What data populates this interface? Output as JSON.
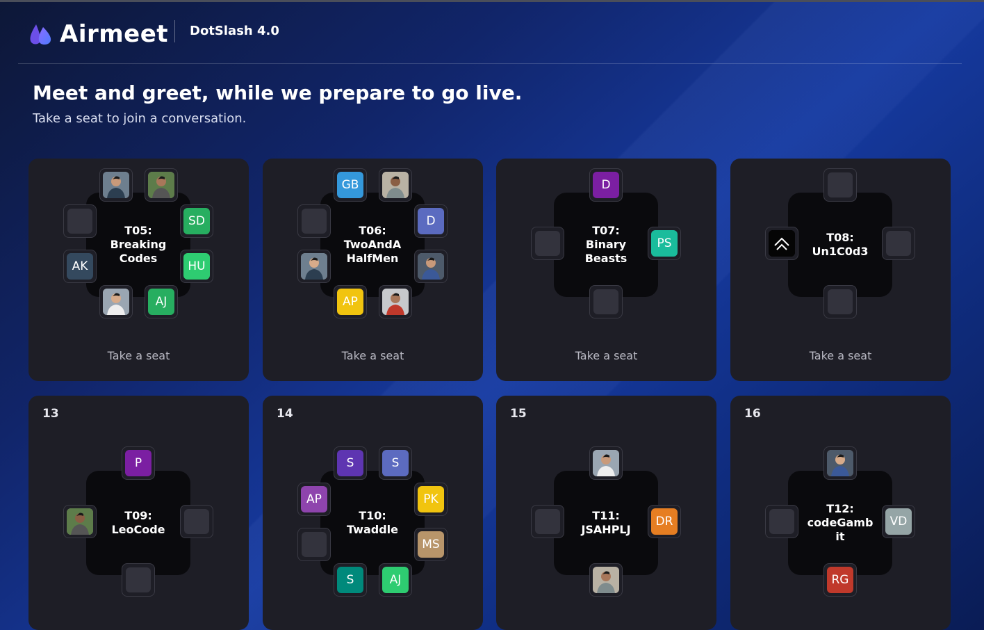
{
  "brand": {
    "name": "Airmeet"
  },
  "event": {
    "name": "DotSlash 4.0"
  },
  "lounge": {
    "heading": "Meet and greet, while we prepare to go live.",
    "subheading": "Take a seat to join a conversation.",
    "take_seat_label": "Take a seat"
  },
  "tables": [
    {
      "number": "",
      "name": "T05: Breaking Codes",
      "seats": [
        {
          "type": "photo"
        },
        {
          "type": "photo"
        },
        {
          "type": "initials",
          "text": "SD",
          "color": "#27ae60"
        },
        {
          "type": "initials",
          "text": "HU",
          "color": "#2ecc71"
        },
        {
          "type": "initials",
          "text": "AJ",
          "color": "#27ae60"
        },
        {
          "type": "photo"
        },
        {
          "type": "initials",
          "text": "AK",
          "color": "#34495e"
        },
        {
          "type": "empty"
        }
      ]
    },
    {
      "number": "",
      "name": "T06: TwoAndA HalfMen",
      "seats": [
        {
          "type": "initials",
          "text": "GB",
          "color": "#3498db"
        },
        {
          "type": "photo"
        },
        {
          "type": "initials",
          "text": "D",
          "color": "#5b6bc0"
        },
        {
          "type": "photo"
        },
        {
          "type": "photo"
        },
        {
          "type": "initials",
          "text": "AP",
          "color": "#f1c40f"
        },
        {
          "type": "photo"
        },
        {
          "type": "empty"
        }
      ]
    },
    {
      "number": "",
      "name": "T07: Binary Beasts",
      "seats": [
        {
          "type": "initials",
          "text": "D",
          "color": "#7b1fa2"
        },
        {
          "type": "initials",
          "text": "PS",
          "color": "#1abc9c"
        },
        {
          "type": "empty"
        },
        {
          "type": "empty"
        }
      ]
    },
    {
      "number": "",
      "name": "T08: Un1C0d3",
      "seats": [
        {
          "type": "empty"
        },
        {
          "type": "empty"
        },
        {
          "type": "empty"
        },
        {
          "type": "logo"
        }
      ]
    },
    {
      "number": "13",
      "name": "T09: LeoCode",
      "seats": [
        {
          "type": "initials",
          "text": "P",
          "color": "#7b1fa2"
        },
        {
          "type": "empty"
        },
        {
          "type": "empty"
        },
        {
          "type": "photo"
        }
      ]
    },
    {
      "number": "14",
      "name": "T10: Twaddle",
      "seats": [
        {
          "type": "initials",
          "text": "S",
          "color": "#5e35b1"
        },
        {
          "type": "initials",
          "text": "S",
          "color": "#5c6bc0"
        },
        {
          "type": "initials",
          "text": "PK",
          "color": "#f1c40f"
        },
        {
          "type": "initials",
          "text": "MS",
          "color": "#b8956a"
        },
        {
          "type": "initials",
          "text": "AJ",
          "color": "#2ecc71"
        },
        {
          "type": "initials",
          "text": "S",
          "color": "#00897b"
        },
        {
          "type": "empty"
        },
        {
          "type": "initials",
          "text": "AP",
          "color": "#8e44ad"
        }
      ]
    },
    {
      "number": "15",
      "name": "T11: JSAHPLJ",
      "seats": [
        {
          "type": "photo"
        },
        {
          "type": "initials",
          "text": "DR",
          "color": "#e67e22"
        },
        {
          "type": "photo"
        },
        {
          "type": "empty"
        }
      ]
    },
    {
      "number": "16",
      "name": "T12: codeGamb it",
      "seats": [
        {
          "type": "photo"
        },
        {
          "type": "initials",
          "text": "VD",
          "color": "#95a5a6"
        },
        {
          "type": "initials",
          "text": "RG",
          "color": "#c0392b"
        },
        {
          "type": "empty"
        }
      ]
    }
  ],
  "colors": {
    "card_bg": "#1e1e26",
    "table_bg": "#0a0a0d",
    "accent": "#7b5cff"
  }
}
